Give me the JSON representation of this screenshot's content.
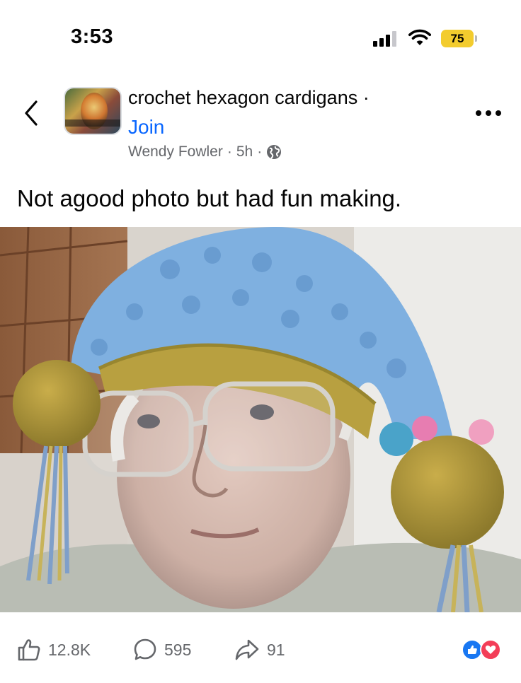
{
  "status_bar": {
    "time": "3:53",
    "battery": "75",
    "battery_color": "#f3cc2e",
    "icons": [
      "cellular-signal-icon",
      "wifi-icon",
      "battery-icon"
    ]
  },
  "post": {
    "group_name": "crochet hexagon cardigans",
    "group_separator": "·",
    "join_label": "Join",
    "author": "Wendy Fowler",
    "time_ago": "5h",
    "privacy_icon": "globe-icon",
    "caption": "Not agood photo but had fun making.",
    "photo_icon": "photo",
    "accent_color": "#0866ff"
  },
  "reactions": {
    "like_count": "12.8K",
    "comment_count": "595",
    "share_count": "91",
    "reaction_icons": [
      "like-reaction-icon",
      "love-reaction-icon"
    ]
  }
}
